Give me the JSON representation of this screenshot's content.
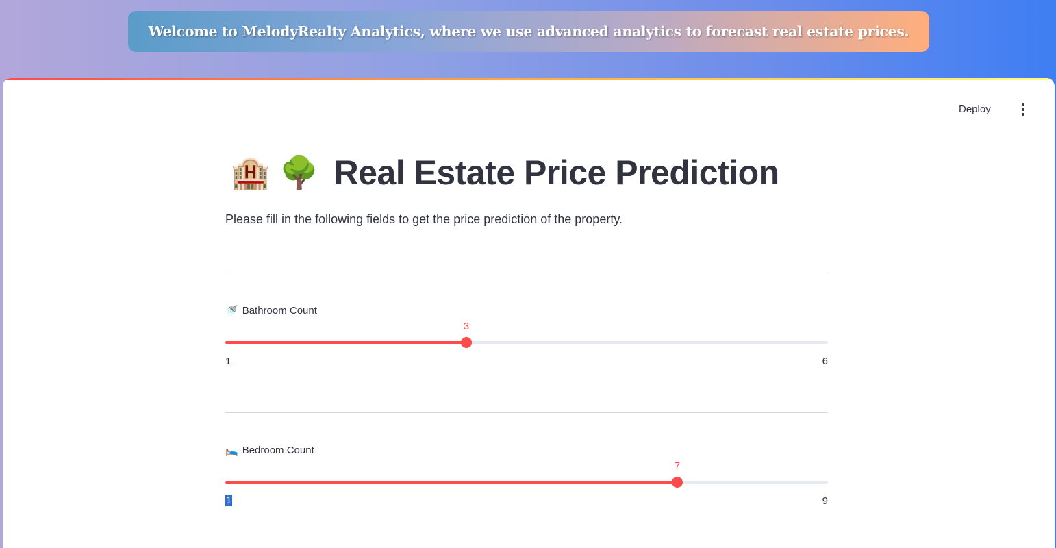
{
  "banner": {
    "text": "Welcome to MelodyRealty Analytics, where we use advanced analytics to forecast real estate prices."
  },
  "toolbar": {
    "deploy_label": "Deploy",
    "menu_icon": "kebab-menu-icon"
  },
  "page": {
    "title_emojis": [
      "🏨",
      "🌳"
    ],
    "title": "Real Estate Price Prediction",
    "subtitle": "Please fill in the following fields to get the price prediction of the property."
  },
  "sliders": [
    {
      "icon": "🚿",
      "label": "Bathroom Count",
      "value": "3",
      "min": "1",
      "max": "6",
      "fraction": 0.4
    },
    {
      "icon": "🛌",
      "label": "Bedroom Count",
      "value": "7",
      "min": "1",
      "max": "9",
      "fraction": 0.75
    }
  ],
  "colors": {
    "accent": "#ff4b4b",
    "text": "#31333f",
    "track": "#e6e9ef"
  }
}
